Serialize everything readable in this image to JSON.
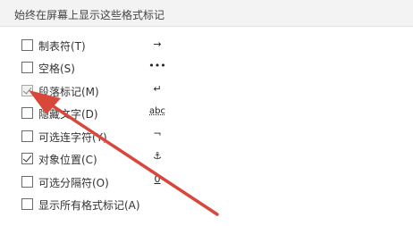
{
  "section": {
    "title": "始终在屏幕上显示这些格式标记"
  },
  "options": [
    {
      "label": "制表符(T)",
      "checked": false,
      "disabled": false,
      "symbol": "→"
    },
    {
      "label": "空格(S)",
      "checked": false,
      "disabled": false,
      "symbol": "•••"
    },
    {
      "label": "段落标记(M)",
      "checked": true,
      "disabled": true,
      "symbol": "↵"
    },
    {
      "label": "隐藏文字(D)",
      "checked": false,
      "disabled": false,
      "symbol": "abc"
    },
    {
      "label": "可选连字符(Y)",
      "checked": false,
      "disabled": false,
      "symbol": "¬"
    },
    {
      "label": "对象位置(C)",
      "checked": true,
      "disabled": false,
      "symbol": "⚓"
    },
    {
      "label": "可选分隔符(O)",
      "checked": false,
      "disabled": false,
      "symbol": "0"
    },
    {
      "label": "显示所有格式标记(A)",
      "checked": false,
      "disabled": false,
      "symbol": ""
    }
  ],
  "annotation": {
    "color": "#d9473b"
  },
  "icons": [
    "tab-arrow-icon",
    "space-dots-icon",
    "paragraph-mark-icon",
    "hidden-text-icon",
    "optional-hyphen-icon",
    "anchor-icon",
    "optional-break-icon"
  ]
}
